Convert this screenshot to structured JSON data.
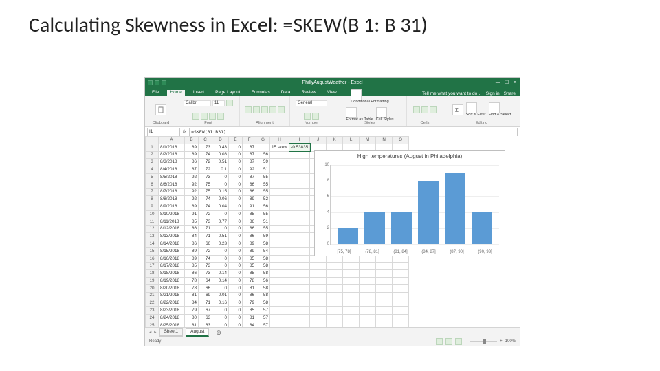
{
  "slide": {
    "title": "Calculating Skewness in Excel: =SKEW(B 1: B 31)"
  },
  "titlebar": {
    "filename": "PhillyAugustWeather - Excel",
    "min": "—",
    "max": "☐",
    "close": "✕"
  },
  "tabs": {
    "items": [
      "File",
      "Home",
      "Insert",
      "Page Layout",
      "Formulas",
      "Data",
      "Review",
      "View"
    ],
    "active": 1,
    "tellme": "Tell me what you want to do…",
    "signin": "Sign in",
    "share": "Share"
  },
  "ribbon": {
    "clipboard": "Clipboard",
    "font": "Font",
    "fontname": "Calibri",
    "fontsize": "11",
    "alignment": "Alignment",
    "number": "Number",
    "numberfmt": "General",
    "styles": "Styles",
    "cond": "Conditional Formatting",
    "fmttable": "Format as Table",
    "cellstyles": "Cell Styles",
    "cells": "Cells",
    "editing": "Editing",
    "sortfilter": "Sort & Filter",
    "findselect": "Find & Select"
  },
  "fxbar": {
    "cell": "I1",
    "fx": "fx",
    "formula": "=SKEW(B1:B31)"
  },
  "columns": [
    "A",
    "B",
    "C",
    "D",
    "E",
    "F",
    "G",
    "H",
    "I",
    "J",
    "K",
    "L",
    "M",
    "N",
    "O"
  ],
  "rows": [
    {
      "r": 1,
      "A": "8/1/2018",
      "B": 89,
      "C": 73,
      "D": 0.43,
      "E": 0,
      "F": 87,
      "G": "",
      "H": "15 skew",
      "I": "-0.53835"
    },
    {
      "r": 2,
      "A": "8/2/2018",
      "B": 89,
      "C": 74,
      "D": 0.08,
      "E": 0,
      "F": 87,
      "G": 56
    },
    {
      "r": 3,
      "A": "8/3/2018",
      "B": 86,
      "C": 72,
      "D": 0.51,
      "E": 0,
      "F": 87,
      "G": 59
    },
    {
      "r": 4,
      "A": "8/4/2018",
      "B": 87,
      "C": 72,
      "D": 0.1,
      "E": 0,
      "F": 92,
      "G": 51
    },
    {
      "r": 5,
      "A": "8/5/2018",
      "B": 92,
      "C": 73,
      "D": 0,
      "E": 0,
      "F": 87,
      "G": 55
    },
    {
      "r": 6,
      "A": "8/6/2018",
      "B": 92,
      "C": 75,
      "D": 0,
      "E": 0,
      "F": 86,
      "G": 55
    },
    {
      "r": 7,
      "A": "8/7/2018",
      "B": 92,
      "C": 75,
      "D": 0.15,
      "E": 0,
      "F": 86,
      "G": 55
    },
    {
      "r": 8,
      "A": "8/8/2018",
      "B": 92,
      "C": 74,
      "D": 0.06,
      "E": 0,
      "F": 89,
      "G": 52
    },
    {
      "r": 9,
      "A": "8/9/2018",
      "B": 89,
      "C": 74,
      "D": 0.04,
      "E": 0,
      "F": 91,
      "G": 56
    },
    {
      "r": 10,
      "A": "8/10/2018",
      "B": 91,
      "C": 72,
      "D": 0,
      "E": 0,
      "F": 85,
      "G": 55
    },
    {
      "r": 11,
      "A": "8/11/2018",
      "B": 85,
      "C": 73,
      "D": 0.77,
      "E": 0,
      "F": 86,
      "G": 51
    },
    {
      "r": 12,
      "A": "8/12/2018",
      "B": 86,
      "C": 71,
      "D": 0,
      "E": 0,
      "F": 86,
      "G": 55
    },
    {
      "r": 13,
      "A": "8/13/2018",
      "B": 84,
      "C": 71,
      "D": 0.51,
      "E": 0,
      "F": 86,
      "G": 59
    },
    {
      "r": 14,
      "A": "8/14/2018",
      "B": 86,
      "C": 66,
      "D": 0.23,
      "E": 0,
      "F": 89,
      "G": 58
    },
    {
      "r": 15,
      "A": "8/15/2018",
      "B": 89,
      "C": 72,
      "D": 0,
      "E": 0,
      "F": 89,
      "G": 54
    },
    {
      "r": 16,
      "A": "8/16/2018",
      "B": 89,
      "C": 74,
      "D": 0,
      "E": 0,
      "F": 85,
      "G": 58
    },
    {
      "r": 17,
      "A": "8/17/2018",
      "B": 85,
      "C": 73,
      "D": 0,
      "E": 0,
      "F": 85,
      "G": 58
    },
    {
      "r": 18,
      "A": "8/18/2018",
      "B": 86,
      "C": 73,
      "D": 0.14,
      "E": 0,
      "F": 85,
      "G": 58
    },
    {
      "r": 19,
      "A": "8/19/2018",
      "B": 78,
      "C": 64,
      "D": 0.14,
      "E": 0,
      "F": 78,
      "G": 56
    },
    {
      "r": 20,
      "A": "8/20/2018",
      "B": 78,
      "C": 66,
      "D": 0,
      "E": 0,
      "F": 81,
      "G": 58
    },
    {
      "r": 21,
      "A": "8/21/2018",
      "B": 81,
      "C": 69,
      "D": 0.01,
      "E": 0,
      "F": 86,
      "G": 58
    },
    {
      "r": 22,
      "A": "8/22/2018",
      "B": 84,
      "C": 71,
      "D": 0.16,
      "E": 0,
      "F": 79,
      "G": 58
    },
    {
      "r": 23,
      "A": "8/23/2018",
      "B": 79,
      "C": 67,
      "D": 0,
      "E": 0,
      "F": 85,
      "G": 57
    },
    {
      "r": 24,
      "A": "8/24/2018",
      "B": 80,
      "C": 63,
      "D": 0,
      "E": 0,
      "F": 81,
      "G": 57
    },
    {
      "r": 25,
      "A": "8/25/2018",
      "B": 81,
      "C": 63,
      "D": 0,
      "E": 0,
      "F": 84,
      "G": 57
    }
  ],
  "chart_data": {
    "type": "bar",
    "title": "High temperatures (August in Philadelphia)",
    "categories": [
      "[75, 78]",
      "(78, 81]",
      "(81, 84]",
      "(84, 87]",
      "(87, 90]",
      "(90, 93]"
    ],
    "values": [
      2,
      4,
      4,
      8,
      9,
      4
    ],
    "ylim": [
      0,
      10
    ],
    "yticks": [
      0,
      2,
      4,
      6,
      8,
      10
    ]
  },
  "sheettabs": {
    "tabs": [
      "Sheet1",
      "August"
    ],
    "active": 1,
    "add": "⊕"
  },
  "status": {
    "ready": "Ready",
    "zoom": "100%",
    "plus": "+",
    "minus": "–"
  }
}
